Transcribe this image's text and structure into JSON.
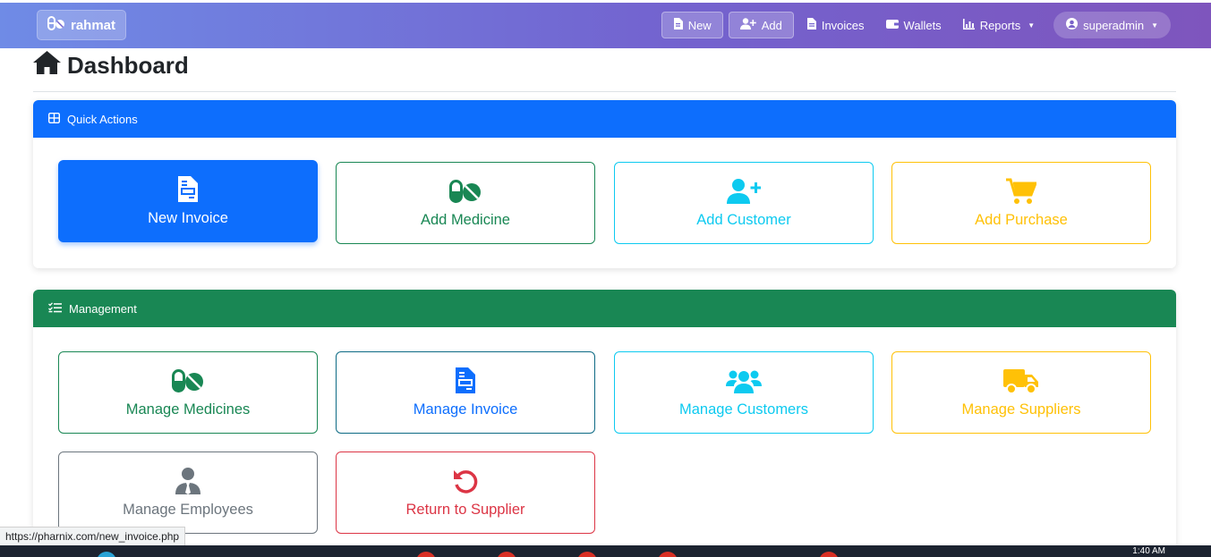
{
  "navbar": {
    "brand": "rahmat",
    "new_label": "New",
    "add_label": "Add",
    "invoices_label": "Invoices",
    "wallets_label": "Wallets",
    "reports_label": "Reports",
    "user_label": "superadmin"
  },
  "page": {
    "title": "Dashboard"
  },
  "quick_actions": {
    "header": "Quick Actions",
    "tiles": [
      {
        "label": "New Invoice",
        "icon": "file-invoice-icon"
      },
      {
        "label": "Add Medicine",
        "icon": "pills-icon"
      },
      {
        "label": "Add Customer",
        "icon": "user-plus-icon"
      },
      {
        "label": "Add Purchase",
        "icon": "cart-icon"
      }
    ]
  },
  "management": {
    "header": "Management",
    "tiles": [
      {
        "label": "Manage Medicines",
        "icon": "pills-icon"
      },
      {
        "label": "Manage Invoice",
        "icon": "file-invoice-icon"
      },
      {
        "label": "Manage Customers",
        "icon": "users-icon"
      },
      {
        "label": "Manage Suppliers",
        "icon": "truck-icon"
      },
      {
        "label": "Manage Employees",
        "icon": "user-tie-icon"
      },
      {
        "label": "Return to Supplier",
        "icon": "undo-icon"
      }
    ]
  },
  "status_bar": {
    "url": "https://pharnix.com/new_invoice.php"
  },
  "taskbar": {
    "clock": "1:40 AM"
  },
  "colors": {
    "primary": "#0d6efd",
    "success": "#198754",
    "info": "#0dcaf0",
    "warning": "#ffc107",
    "secondary": "#6c757d",
    "danger": "#dc3545"
  }
}
